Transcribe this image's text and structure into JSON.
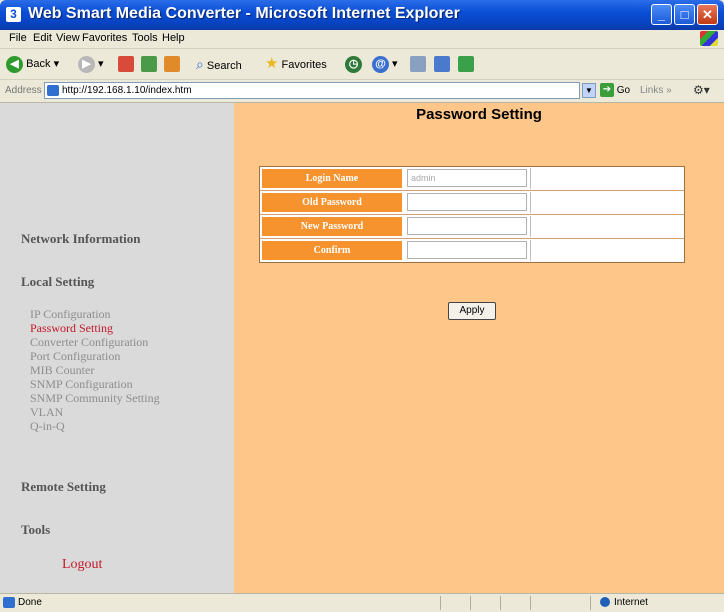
{
  "window": {
    "title": "Web Smart Media Converter - Microsoft Internet Explorer",
    "app_icon": "3"
  },
  "menu": {
    "items": [
      "File",
      "Edit",
      "View",
      "Favorites",
      "Tools",
      "Help"
    ]
  },
  "toolbar": {
    "back": "Back",
    "search": "Search",
    "favorites": "Favorites"
  },
  "address": {
    "label": "Address",
    "url": "http://192.168.1.10/index.htm",
    "go": "Go",
    "links": "Links"
  },
  "sidebar": {
    "network_information": "Network Information",
    "local_setting": "Local Setting",
    "local_items": [
      "IP Configuration",
      "Password Setting",
      "Converter Configuration",
      "Port Configuration",
      "MIB Counter",
      "SNMP Configuration",
      "SNMP Community Setting",
      "VLAN",
      "Q-in-Q"
    ],
    "active_item": "Password Setting",
    "remote_setting": "Remote Setting",
    "tools": "Tools",
    "logout": "Logout"
  },
  "main": {
    "title": "Password Setting",
    "form": {
      "rows": [
        {
          "label": "Login Name",
          "value": "admin"
        },
        {
          "label": "Old Password",
          "value": ""
        },
        {
          "label": "New Password",
          "value": ""
        },
        {
          "label": "Confirm",
          "value": ""
        }
      ]
    },
    "apply_label": "Apply"
  },
  "status": {
    "text": "Done",
    "zone": "Internet"
  },
  "colors": {
    "main_background": "#ffc68a",
    "label_background": "#f7932f",
    "sidebar_background": "#dadada",
    "active_link": "#c2182b"
  }
}
